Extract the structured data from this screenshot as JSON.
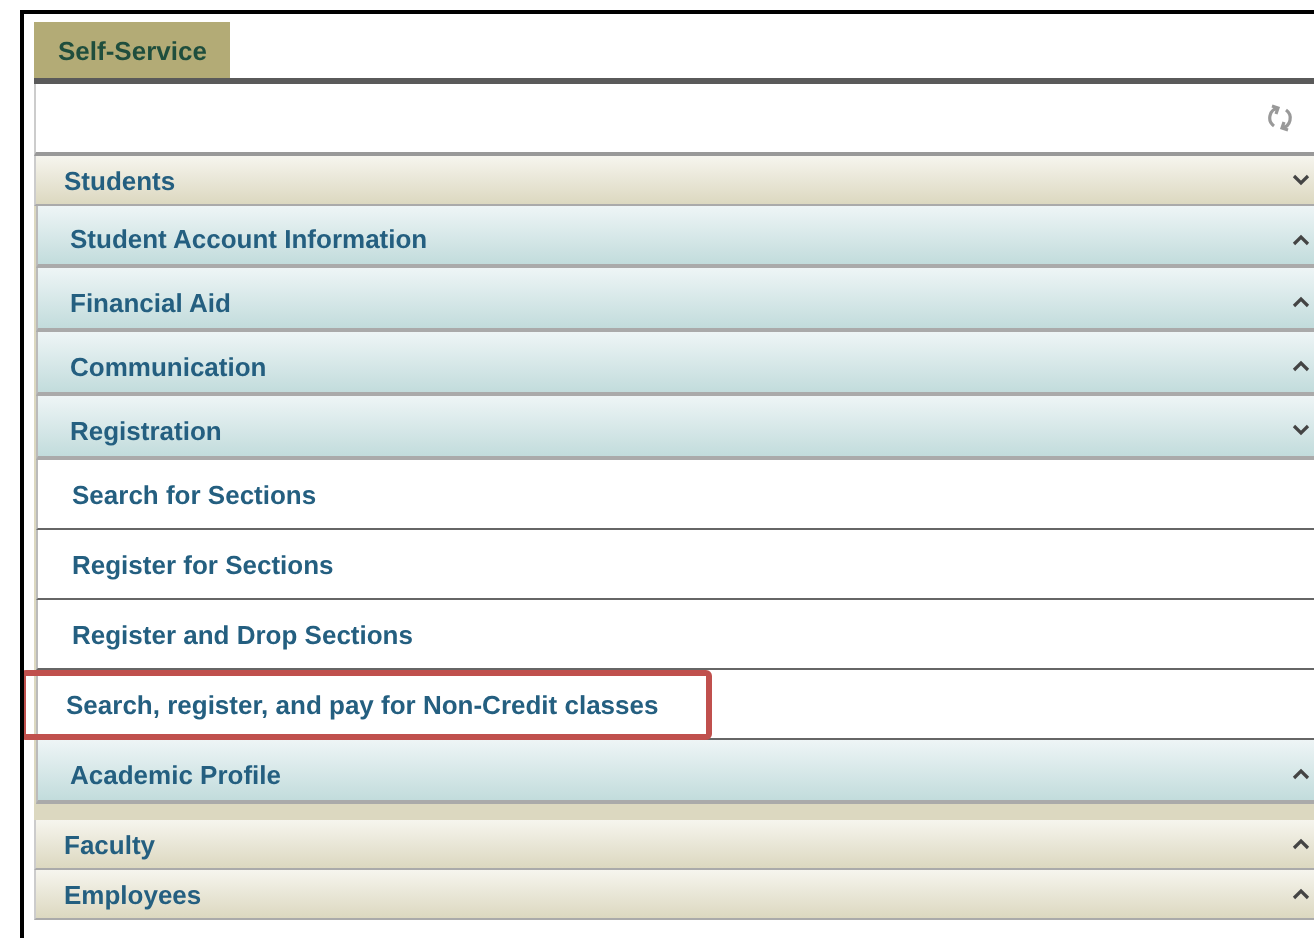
{
  "tabs": [
    {
      "label": "Self-Service",
      "selected": true
    }
  ],
  "sections": [
    {
      "title": "Students",
      "expanded": true,
      "children": [
        {
          "title": "Student Account Information",
          "expanded": false
        },
        {
          "title": "Financial Aid",
          "expanded": false
        },
        {
          "title": "Communication",
          "expanded": false
        },
        {
          "title": "Registration",
          "expanded": true,
          "links": [
            {
              "label": "Search for Sections",
              "highlighted": false
            },
            {
              "label": "Register for Sections",
              "highlighted": false
            },
            {
              "label": "Register and Drop Sections",
              "highlighted": false
            },
            {
              "label": "Search, register, and pay for Non-Credit classes",
              "highlighted": true
            }
          ]
        },
        {
          "title": "Academic Profile",
          "expanded": false
        }
      ]
    },
    {
      "title": "Faculty",
      "expanded": false
    },
    {
      "title": "Employees",
      "expanded": false
    }
  ]
}
